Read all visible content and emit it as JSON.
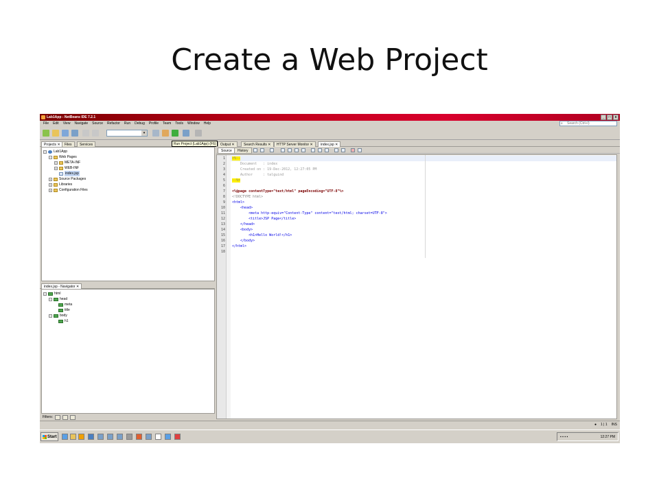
{
  "slide": {
    "title": "Create a Web Project"
  },
  "window": {
    "title": "Lab1App - NetBeans IDE 7.2.1",
    "controls": [
      "_",
      "□",
      "x"
    ]
  },
  "menu": [
    "File",
    "Edit",
    "View",
    "Navigate",
    "Source",
    "Refactor",
    "Run",
    "Debug",
    "Profile",
    "Team",
    "Tools",
    "Window",
    "Help"
  ],
  "search": {
    "placeholder": "Search (Ctrl+I)"
  },
  "tooltip": "Run Project (Lab1App) (F6)",
  "left_tabs": [
    "Projects",
    "Files",
    "Services"
  ],
  "project_tree": [
    {
      "label": "Lab1App",
      "icon": "project-icon",
      "expander": "−"
    },
    {
      "label": "Web Pages",
      "icon": "folder-icon",
      "expander": "−"
    },
    {
      "label": "META-INF",
      "icon": "folder-icon",
      "expander": "+"
    },
    {
      "label": "WEB-INF",
      "icon": "folder-icon",
      "expander": "+"
    },
    {
      "label": "index.jsp",
      "icon": "jsp-file-icon",
      "expander": ""
    },
    {
      "label": "Source Packages",
      "icon": "folder-icon",
      "expander": "+"
    },
    {
      "label": "Libraries",
      "icon": "folder-icon",
      "expander": "+"
    },
    {
      "label": "Configuration Files",
      "icon": "folder-icon",
      "expander": "+"
    }
  ],
  "navigator": {
    "tab": "index.jsp - Navigator",
    "tree": [
      {
        "label": "html",
        "expander": "−"
      },
      {
        "label": "head",
        "expander": "−"
      },
      {
        "label": "meta",
        "expander": ""
      },
      {
        "label": "title",
        "expander": ""
      },
      {
        "label": "body",
        "expander": "−"
      },
      {
        "label": "h1",
        "expander": ""
      }
    ],
    "filters_label": "Filters:"
  },
  "editor_tabs": [
    "Output",
    "Search Results",
    "HTTP Server Monitor",
    "index.jsp"
  ],
  "editor_subtabs": [
    "Source",
    "History"
  ],
  "code_lines": [
    {
      "n": "1",
      "t": "<%--"
    },
    {
      "n": "2",
      "t": "    Document   : index"
    },
    {
      "n": "3",
      "t": "    Created on : 19-Dec-2012, 12:27:05 PM"
    },
    {
      "n": "4",
      "t": "    Author     : talguind"
    },
    {
      "n": "5",
      "t": "--%>"
    },
    {
      "n": "6",
      "t": ""
    },
    {
      "n": "7",
      "t": "<%@page contentType=\"text/html\" pageEncoding=\"UTF-8\"%>"
    },
    {
      "n": "8",
      "t": "<!DOCTYPE html>"
    },
    {
      "n": "9",
      "t": "<html>"
    },
    {
      "n": "10",
      "t": "    <head>"
    },
    {
      "n": "11",
      "t": "        <meta http-equiv=\"Content-Type\" content=\"text/html; charset=UTF-8\">"
    },
    {
      "n": "12",
      "t": "        <title>JSP Page</title>"
    },
    {
      "n": "13",
      "t": "    </head>"
    },
    {
      "n": "14",
      "t": "    <body>"
    },
    {
      "n": "15",
      "t": "        <h1>Hello World!</h1>"
    },
    {
      "n": "16",
      "t": "    </body>"
    },
    {
      "n": "17",
      "t": "</html>"
    },
    {
      "n": "18",
      "t": ""
    }
  ],
  "status": {
    "position": "1 | 1",
    "mode": "INS"
  },
  "taskbar": {
    "start_label": "Start",
    "clock": "12:27 PM"
  },
  "colors": {
    "titlebar": "#c0001a",
    "selection": "#c2d5f2",
    "tag": "#0000e6",
    "string": "#ce7b00",
    "comment_marker": "#fff000"
  }
}
